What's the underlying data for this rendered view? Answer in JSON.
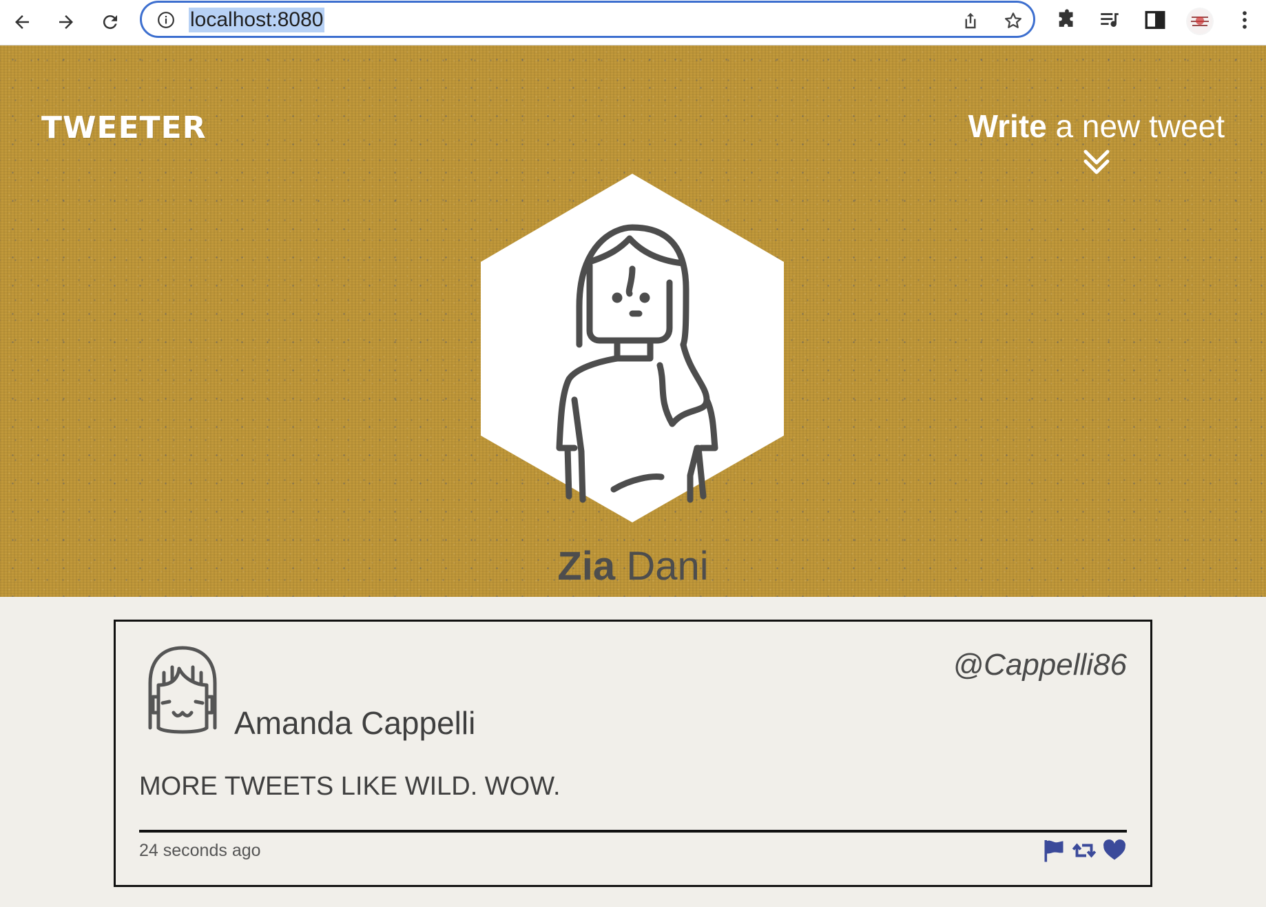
{
  "browser": {
    "url": "localhost:8080",
    "icons": [
      "back-icon",
      "forward-icon",
      "reload-icon",
      "site-info-icon",
      "share-icon",
      "bookmark-star-icon",
      "extensions-icon",
      "media-controls-icon",
      "side-panel-icon",
      "profile-avatar",
      "menu-kebab-icon"
    ]
  },
  "header": {
    "logo": "TWEETER",
    "write_bold": "Write",
    "write_rest": " a new tweet",
    "profile_first": "Zia",
    "profile_last": "Dani",
    "banner_color": "#c2993a"
  },
  "tweet": {
    "author_name": "Amanda Cappelli",
    "handle": "@Cappelli86",
    "content": "MORE TWEETS LIKE WILD. WOW.",
    "timestamp": "24 seconds ago",
    "action_icons": [
      "flag-icon",
      "retweet-icon",
      "heart-icon"
    ],
    "action_color": "#3b4a9a"
  }
}
